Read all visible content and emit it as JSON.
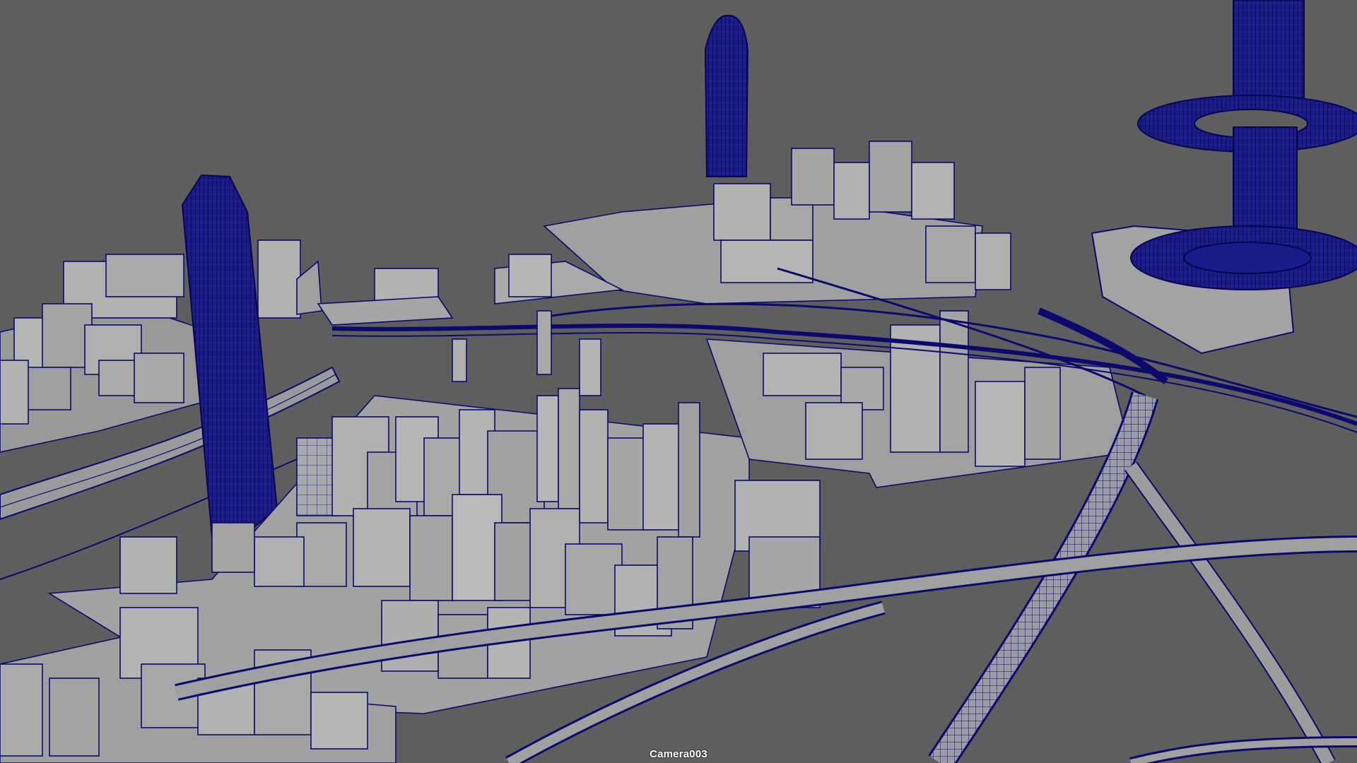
{
  "viewport": {
    "camera_name": "Camera003",
    "display_mode": "wireframe-on-shaded",
    "background_color": "#5e5e5e",
    "surface_color": "#a9a9a9",
    "wire_color": "#0a0a6e",
    "selected_wire_color": "#0a0a6e"
  }
}
